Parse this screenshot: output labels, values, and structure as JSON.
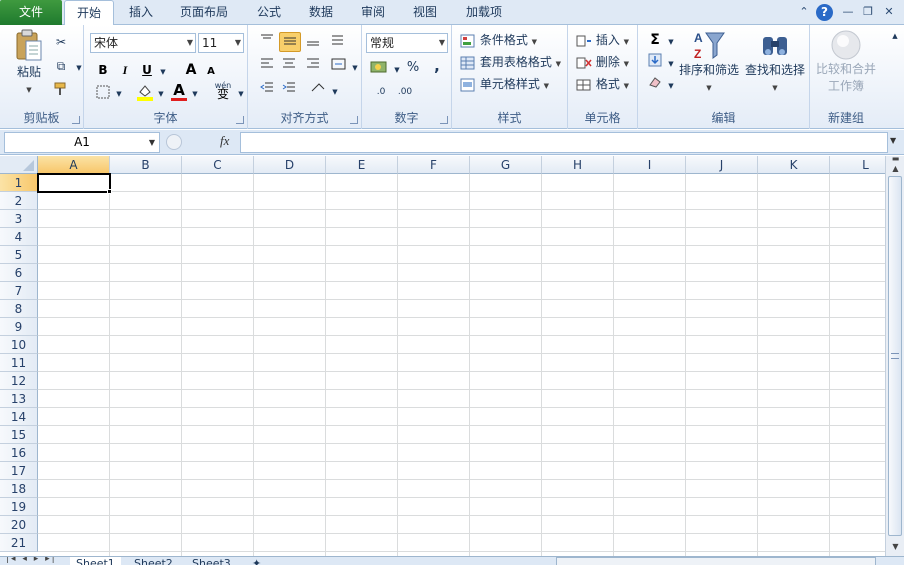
{
  "tabs": [
    {
      "label": "文件"
    },
    {
      "label": "开始"
    },
    {
      "label": "插入"
    },
    {
      "label": "页面布局"
    },
    {
      "label": "公式"
    },
    {
      "label": "数据"
    },
    {
      "label": "审阅"
    },
    {
      "label": "视图"
    },
    {
      "label": "加载项"
    }
  ],
  "window": {
    "help": "?",
    "minimize_ribbon": "⌃",
    "minimize": "—",
    "restore": "❐",
    "close": "✕"
  },
  "clipboard": {
    "paste": "粘贴",
    "cut_icon": "scissors-icon",
    "group": "剪贴板"
  },
  "font": {
    "name": "宋体",
    "size": "11",
    "bold": "B",
    "italic": "I",
    "underline": "U",
    "grow": "A",
    "shrink": "A",
    "wen": "wén",
    "wen2": "变",
    "group": "字体"
  },
  "alignment": {
    "group": "对齐方式"
  },
  "number": {
    "format": "常规",
    "percent": "%",
    "comma": ",",
    "inc": ".0",
    "dec": ".00",
    "group": "数字"
  },
  "styles": {
    "conditional": "条件格式",
    "table": "套用表格格式",
    "cell": "单元格样式",
    "group": "样式"
  },
  "cells": {
    "insert": "插入",
    "delete": "删除",
    "format": "格式",
    "group": "单元格"
  },
  "editing": {
    "sum": "Σ",
    "sort": "排序和筛选",
    "find": "查找和选择",
    "group": "编辑"
  },
  "newgroup": {
    "compare_line1": "比较和合并",
    "compare_line2": "工作簿",
    "group": "新建组"
  },
  "formula": {
    "namebox": "A1",
    "fx": "fx"
  },
  "columns": [
    "A",
    "B",
    "C",
    "D",
    "E",
    "F",
    "G",
    "H",
    "I",
    "J",
    "K",
    "L"
  ],
  "rows": [
    "1",
    "2",
    "3",
    "4",
    "5",
    "6",
    "7",
    "8",
    "9",
    "10",
    "11",
    "12",
    "13",
    "14",
    "15",
    "16",
    "17",
    "18",
    "19",
    "20",
    "21"
  ],
  "sheets": [
    {
      "label": "Sheet1"
    },
    {
      "label": "Sheet2"
    },
    {
      "label": "Sheet3"
    }
  ],
  "colors": {
    "file_tab": "#2b8a3a",
    "font_color_bar": "#e01e1e",
    "highlight_bar": "#ffff00",
    "selected_header": "#f8c76b"
  }
}
